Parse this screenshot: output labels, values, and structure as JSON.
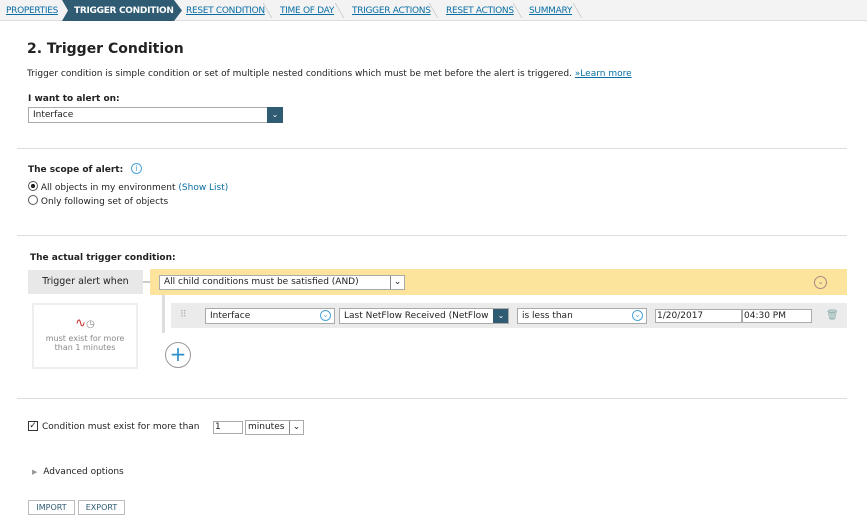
{
  "wizard_steps": [
    "PROPERTIES",
    "TRIGGER CONDITION",
    "RESET CONDITION",
    "TIME OF DAY",
    "TRIGGER ACTIONS",
    "RESET ACTIONS",
    "SUMMARY"
  ],
  "active_step": "TRIGGER CONDITION",
  "title": "2. Trigger Condition",
  "description": "Trigger condition is simple condition or set of multiple nested conditions which must be met before the alert is triggered.",
  "learn_more": "»Learn more",
  "alert_on": {
    "label": "I want to alert on:",
    "value": "Interface"
  },
  "scope": {
    "label": "The scope of alert:",
    "option1": "All objects in my environment",
    "show_list": "(Show List)",
    "option2": "Only following set of objects",
    "selected": "option1"
  },
  "trigger": {
    "label": "The actual trigger condition:",
    "when_label": "Trigger alert when",
    "group_value": "All child conditions must be satisfied (AND)",
    "summary": "must exist for more than 1 minutes",
    "row": {
      "object": "Interface",
      "field": "Last NetFlow Received (NetFlow",
      "operator": "is less than",
      "date": "1/20/2017",
      "time": "04:30 PM"
    }
  },
  "condition_exist": {
    "label": "Condition must exist for more than",
    "checked": true,
    "value": "1",
    "unit": "minutes"
  },
  "advanced": "Advanced options",
  "buttons": {
    "import": "IMPORT",
    "export": "EXPORT"
  },
  "colors": {
    "accent": "#2f5b73",
    "highlight": "#fde49c",
    "link": "#0a6ea5"
  }
}
